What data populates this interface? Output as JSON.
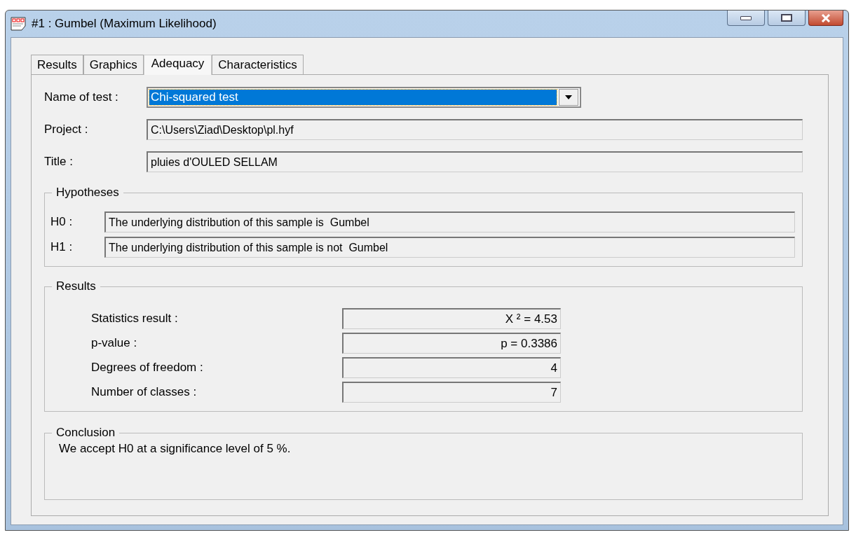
{
  "window": {
    "title": "#1 : Gumbel (Maximum Likelihood)"
  },
  "tabs": [
    {
      "label": "Results",
      "selected": false
    },
    {
      "label": "Graphics",
      "selected": false
    },
    {
      "label": "Adequacy",
      "selected": true
    },
    {
      "label": "Characteristics",
      "selected": false
    }
  ],
  "fields": [
    {
      "kind": "combo",
      "label": "Name of test :",
      "value": "Chi-squared test",
      "selected": true
    },
    {
      "kind": "text",
      "label": "Project :",
      "value": "C:\\Users\\Ziad\\Desktop\\pl.hyf"
    },
    {
      "kind": "text",
      "label": "Title :",
      "value": "pluies d'OULED SELLAM"
    }
  ],
  "hypotheses": {
    "title": "Hypotheses",
    "rows": [
      {
        "label": "H0 :",
        "value": "The underlying distribution of this sample is  Gumbel"
      },
      {
        "label": "H1 :",
        "value": "The underlying distribution of this sample is not  Gumbel"
      }
    ]
  },
  "results": {
    "title": "Results",
    "rows": [
      {
        "label": "Statistics result :",
        "value": "X ² = 4.53"
      },
      {
        "label": "p-value :",
        "value": "p = 0.3386"
      },
      {
        "label": "Degrees of freedom :",
        "value": "4"
      },
      {
        "label": "Number of classes :",
        "value": "7"
      }
    ]
  },
  "conclusion": {
    "title": "Conclusion",
    "text": "We accept H0 at a significance level of 5 %."
  }
}
